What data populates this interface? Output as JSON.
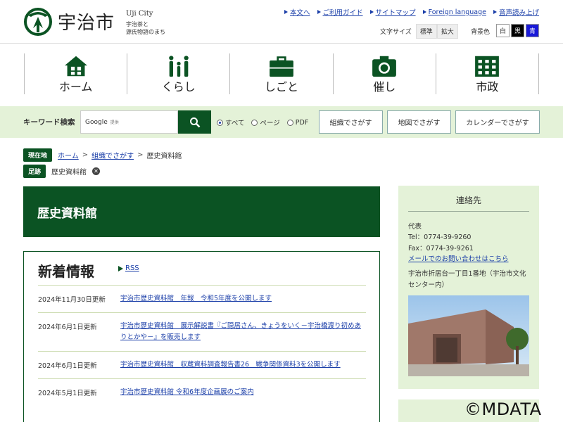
{
  "header": {
    "site_name": "宇治市",
    "site_en": "Uji City",
    "tagline_1": "宇治茶と",
    "tagline_2": "源氏物語のまち",
    "util_links": [
      "本文へ",
      "ご利用ガイド",
      "サイトマップ",
      "Foreign language",
      "音声読み上げ"
    ],
    "text_size_label": "文字サイズ",
    "text_size_standard": "標準",
    "text_size_large": "拡大",
    "bg_color_label": "背景色",
    "bg_white": "白",
    "bg_black": "黒",
    "bg_blue": "青"
  },
  "nav": [
    {
      "label": "ホーム",
      "icon": "house-icon"
    },
    {
      "label": "くらし",
      "icon": "family-icon"
    },
    {
      "label": "しごと",
      "icon": "briefcase-icon"
    },
    {
      "label": "催し",
      "icon": "camera-icon"
    },
    {
      "label": "市政",
      "icon": "building-icon"
    }
  ],
  "search": {
    "label": "キーワード検索",
    "google": "Google",
    "google_sub": "提供",
    "scope_all": "すべて",
    "scope_page": "ページ",
    "scope_pdf": "PDF",
    "btn_org": "組織でさがす",
    "btn_map": "地図でさがす",
    "btn_calendar": "カレンダーでさがす"
  },
  "breadcrumb": {
    "current_tag": "現在地",
    "items": [
      "ホーム",
      "組織でさがす",
      "歴史資料館"
    ],
    "history_tag": "足跡",
    "history_item": "歴史資料館"
  },
  "page": {
    "title": "歴史資料館"
  },
  "news": {
    "heading": "新着情報",
    "rss": "RSS",
    "items": [
      {
        "date": "2024年11月30日更新",
        "title": "宇治市歴史資料館　年報　令和5年度を公開します"
      },
      {
        "date": "2024年6月1日更新",
        "title": "宇治市歴史資料館　展示解説書『ご隠居さん、きょうをいく－宇治橋渡り初めありとかや－』を販売します"
      },
      {
        "date": "2024年6月1日更新",
        "title": "宇治市歴史資料館　収蔵資料調査報告書26　戦争関係資料3を公開します"
      },
      {
        "date": "2024年5月1日更新",
        "title": "宇治市歴史資料館 令和6年度企画展のご案内"
      }
    ]
  },
  "contact": {
    "title": "連絡先",
    "dept": "代表",
    "tel": "Tel：0774-39-9260",
    "fax": "Fax：0774-39-9261",
    "mail_link": "メールでのお問い合わせはこちら",
    "address": "宇治市折居台一丁目1番地（宇治市文化センター内）"
  },
  "watermark": "©MDATA",
  "colors": {
    "brand_green": "#0b5323",
    "band_green": "#e4f2d8",
    "link_blue": "#1a3ea8"
  }
}
